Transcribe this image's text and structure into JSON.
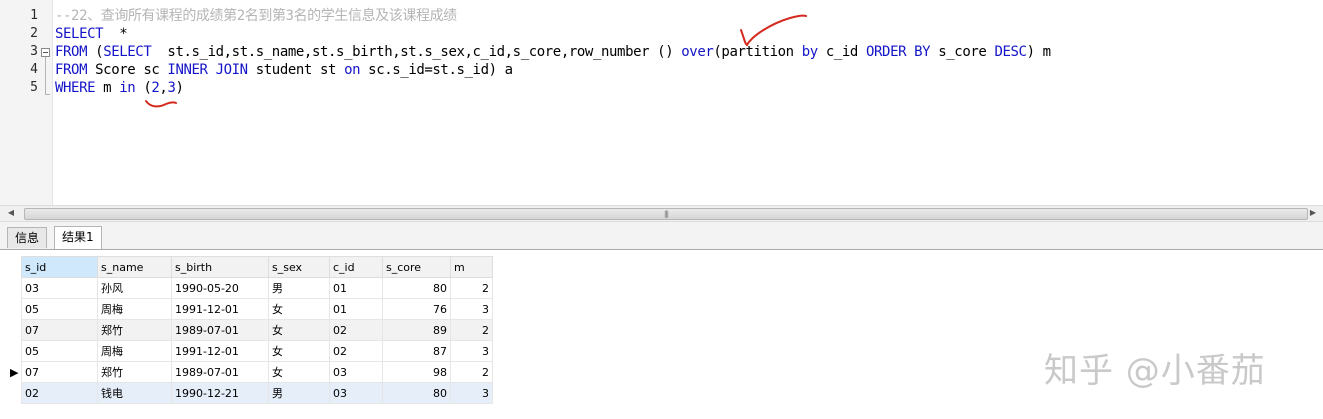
{
  "editor": {
    "line_numbers": [
      "1",
      "2",
      "3",
      "4",
      "5"
    ],
    "line1": {
      "comment": "--22、查询所有课程的成绩第2名到第3名的学生信息及该课程成绩"
    },
    "line2": {
      "k1": "SELECT",
      "t1": "  *"
    },
    "line3": {
      "k1": "FROM",
      "t1": " (",
      "k2": "SELECT",
      "t2": "  st.s_id,st.s_name,st.s_birth,st.s_sex,c_id,s_core,row_number () ",
      "k3": "over",
      "t3": "(partition ",
      "k4": "by",
      "t4": " c_id ",
      "k5": "ORDER BY",
      "t5": " s_core ",
      "k6": "DESC",
      "t6": ") m"
    },
    "line4": {
      "k1": "FROM",
      "t1": " Score sc ",
      "k2": "INNER JOIN",
      "t2": " student st ",
      "k3": "on",
      "t3": " sc.s_id=st.s_id) a"
    },
    "line5": {
      "k1": "WHERE",
      "t1": " m ",
      "k2": "in",
      "t2": " (",
      "n1": "2",
      "t3": ",",
      "n2": "3",
      "t4": ")"
    }
  },
  "tabs": [
    "信息",
    "结果1"
  ],
  "grid": {
    "columns": [
      "s_id",
      "s_name",
      "s_birth",
      "s_sex",
      "c_id",
      "s_core",
      "m"
    ],
    "rows": [
      [
        "03",
        "孙风",
        "1990-05-20",
        "男",
        "01",
        "80",
        "2"
      ],
      [
        "05",
        "周梅",
        "1991-12-01",
        "女",
        "01",
        "76",
        "3"
      ],
      [
        "07",
        "郑竹",
        "1989-07-01",
        "女",
        "02",
        "89",
        "2"
      ],
      [
        "05",
        "周梅",
        "1991-12-01",
        "女",
        "02",
        "87",
        "3"
      ],
      [
        "07",
        "郑竹",
        "1989-07-01",
        "女",
        "03",
        "98",
        "2"
      ],
      [
        "02",
        "钱电",
        "1990-12-21",
        "男",
        "03",
        "80",
        "3"
      ]
    ],
    "current_row_marker": "▶"
  },
  "watermark": "知乎 @小番茄",
  "colors": {
    "keyword": "#1414c8",
    "comment": "#b5b5b5",
    "pen": "#d42a1f"
  }
}
